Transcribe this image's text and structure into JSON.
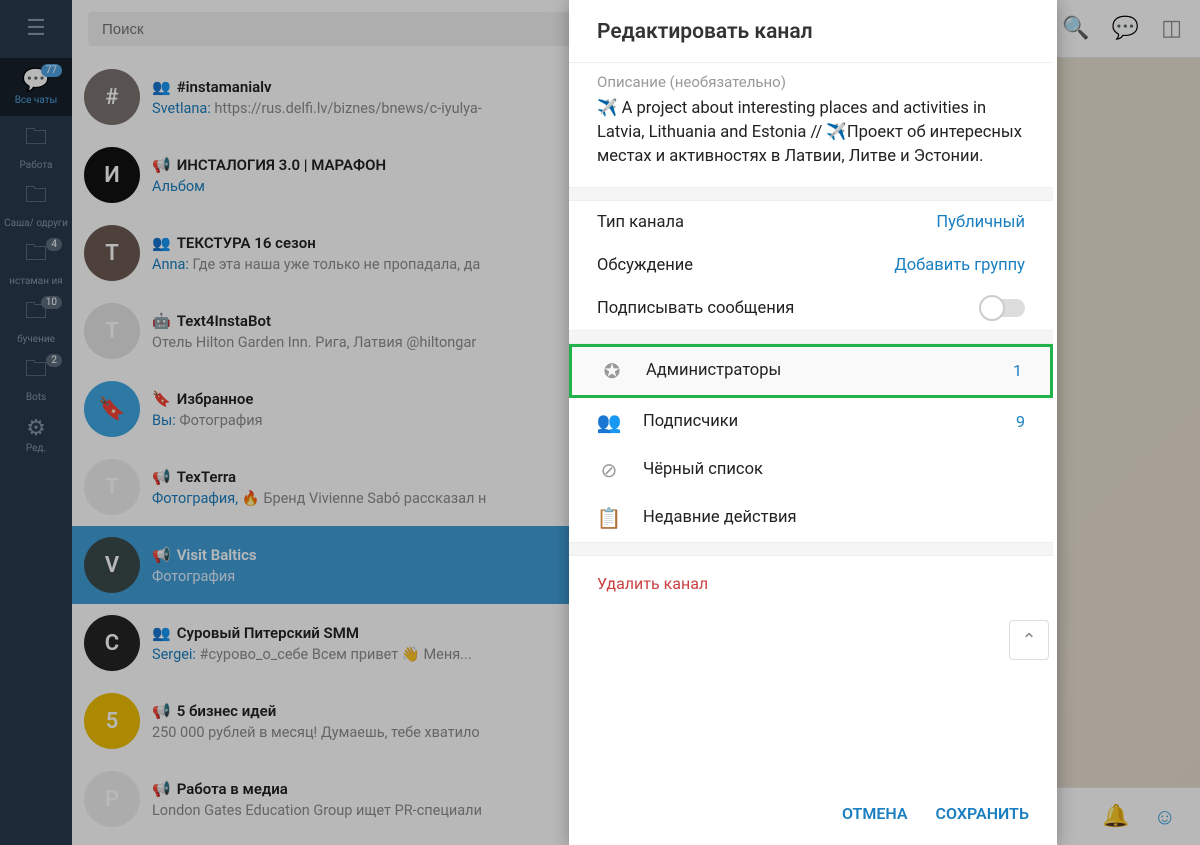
{
  "search": {
    "placeholder": "Поиск"
  },
  "rail": [
    {
      "label": "",
      "badge": ""
    },
    {
      "label": "Все чаты",
      "badge": "77"
    },
    {
      "label": "Работа",
      "badge": ""
    },
    {
      "label": "Саша/ одруги",
      "badge": ""
    },
    {
      "label": "нстаман ия",
      "badge": "4"
    },
    {
      "label": "бучение",
      "badge": "10"
    },
    {
      "label": "Bots",
      "badge": "2"
    },
    {
      "label": "Ред.",
      "badge": ""
    }
  ],
  "chats": [
    {
      "title": "#instamanialv",
      "sender": "Svetlana",
      "preview": "https://rus.delfi.lv/biznes/bnews/c-iyulya-",
      "type": "group",
      "av": "#7a726f"
    },
    {
      "title": "ИНСТАЛОГИЯ 3.0 | МАРАФОН",
      "sender": "",
      "preview": "Альбом",
      "type": "channel",
      "av": "#111"
    },
    {
      "title": "ТЕКСТУРА 16 сезон",
      "sender": "Anna",
      "preview": "Где эта наша уже только не пропадала, да",
      "type": "group",
      "av": "#6c5b53"
    },
    {
      "title": "Text4InstaBot",
      "sender": "",
      "preview": "Отель Hilton Garden Inn. Рига, Латвия @hiltongar",
      "type": "bot",
      "av": "#e5e5e5"
    },
    {
      "title": "Избранное",
      "sender": "Вы",
      "preview": "Фотография",
      "type": "saved",
      "av": "#40a7e3"
    },
    {
      "title": "TexTerra",
      "sender": "",
      "preview": "Фотография, 🔥 Бренд Vivienne Sabó рассказал н",
      "type": "channel",
      "av": "#efefef"
    },
    {
      "title": "Visit Baltics",
      "sender": "",
      "preview": "Фотография",
      "type": "channel",
      "av": "#3b4c4c",
      "selected": true
    },
    {
      "title": "Суровый Питерский SMM",
      "sender": "Sergei",
      "preview": "#сурово_о_себе  Всем привет 👋  Меня...",
      "type": "group",
      "av": "#242424"
    },
    {
      "title": "5 бизнес идей",
      "sender": "",
      "preview": "250 000 рублей в месяц!  Думаешь, тебе хватило",
      "type": "channel",
      "av": "#eebe02"
    },
    {
      "title": "Работа в медиа",
      "sender": "",
      "preview": "London Gates Education Group ищет PR-специали",
      "type": "channel",
      "av": "#efefef"
    }
  ],
  "modal": {
    "title": "Редактировать канал",
    "desc_label": "Описание (необязательно)",
    "desc_text": "✈️ A project about interesting places and activities in Latvia, Lithuania and Estonia // ✈️Проект об интересных местах и активностях в Латвии, Литве и Эстонии.",
    "type_label": "Тип канала",
    "type_value": "Публичный",
    "disc_label": "Обсуждение",
    "disc_value": "Добавить группу",
    "sign_label": "Подписывать сообщения",
    "menu": {
      "admins": {
        "label": "Администраторы",
        "count": "1"
      },
      "subs": {
        "label": "Подписчики",
        "count": "9"
      },
      "black": {
        "label": "Чёрный список"
      },
      "recent": {
        "label": "Недавние действия"
      }
    },
    "delete": "Удалить канал",
    "cancel": "ОТМЕНА",
    "save": "СОХРАНИТЬ"
  }
}
